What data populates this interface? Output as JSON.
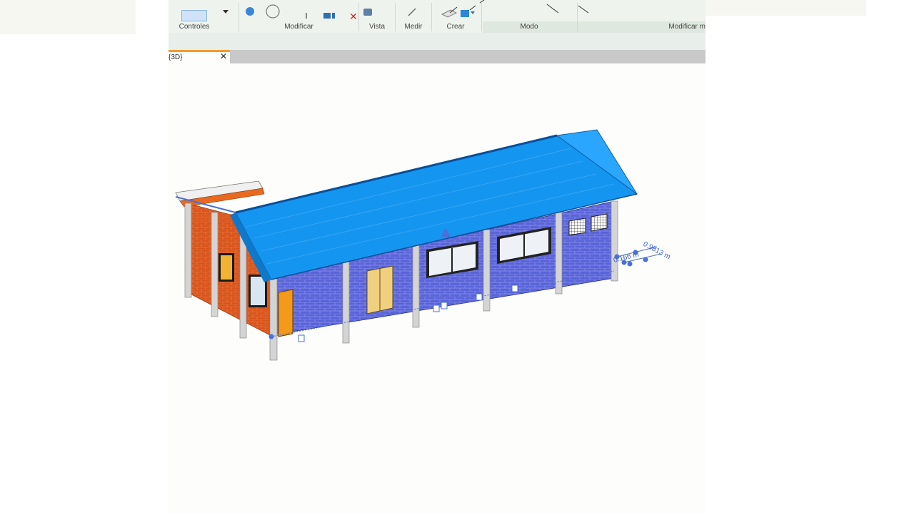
{
  "ribbon": {
    "panels": [
      {
        "label": "Controles"
      },
      {
        "label": "Modificar"
      },
      {
        "label": "Vista"
      },
      {
        "label": "Medir"
      },
      {
        "label": "Crear"
      },
      {
        "label": "Modo"
      },
      {
        "label": "Modificar m"
      }
    ]
  },
  "tab": {
    "label": "{3D}",
    "close": "✕"
  },
  "viewport": {
    "dimension_1": "0.9813 m",
    "dimension_2": "0.166 m"
  },
  "colors": {
    "roof": "#1496f0",
    "brick_blue": "#5a64d8",
    "brick_orange": "#d8541c",
    "column": "#cfcfcf",
    "selection": "#4a6fd8",
    "tab_accent": "#f39a2b"
  }
}
